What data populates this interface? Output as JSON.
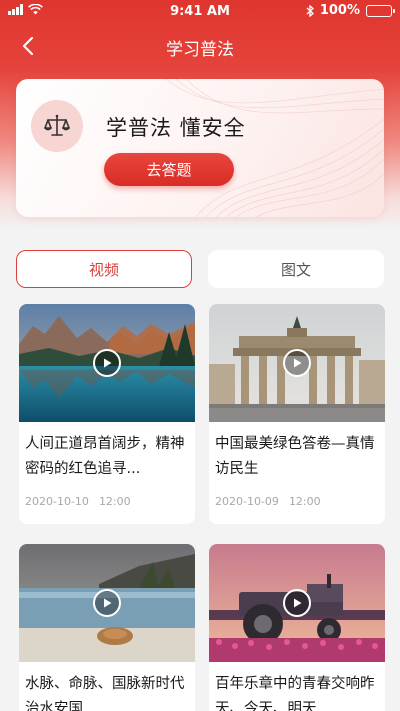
{
  "status_bar": {
    "time": "9:41 AM",
    "battery": "100%"
  },
  "nav": {
    "title": "学习普法"
  },
  "promo": {
    "title": "学普法 懂安全",
    "button_label": "去答题"
  },
  "tabs": [
    {
      "label": "视频",
      "active": true
    },
    {
      "label": "图文",
      "active": false
    }
  ],
  "cards": [
    {
      "title": "人间正道昂首阔步，精神密码的红色追寻...",
      "date": "2020-10-10",
      "time": "12:00"
    },
    {
      "title": "中国最美绿色答卷—真情访民生",
      "date": "2020-10-09",
      "time": "12:00"
    },
    {
      "title": "水脉、命脉、国脉新时代治水安国",
      "date": "",
      "time": ""
    },
    {
      "title": "百年乐章中的青春交响昨天、今天、明天",
      "date": "",
      "time": ""
    }
  ],
  "colors": {
    "accent": "#d9403a",
    "header": "#e0352f"
  }
}
